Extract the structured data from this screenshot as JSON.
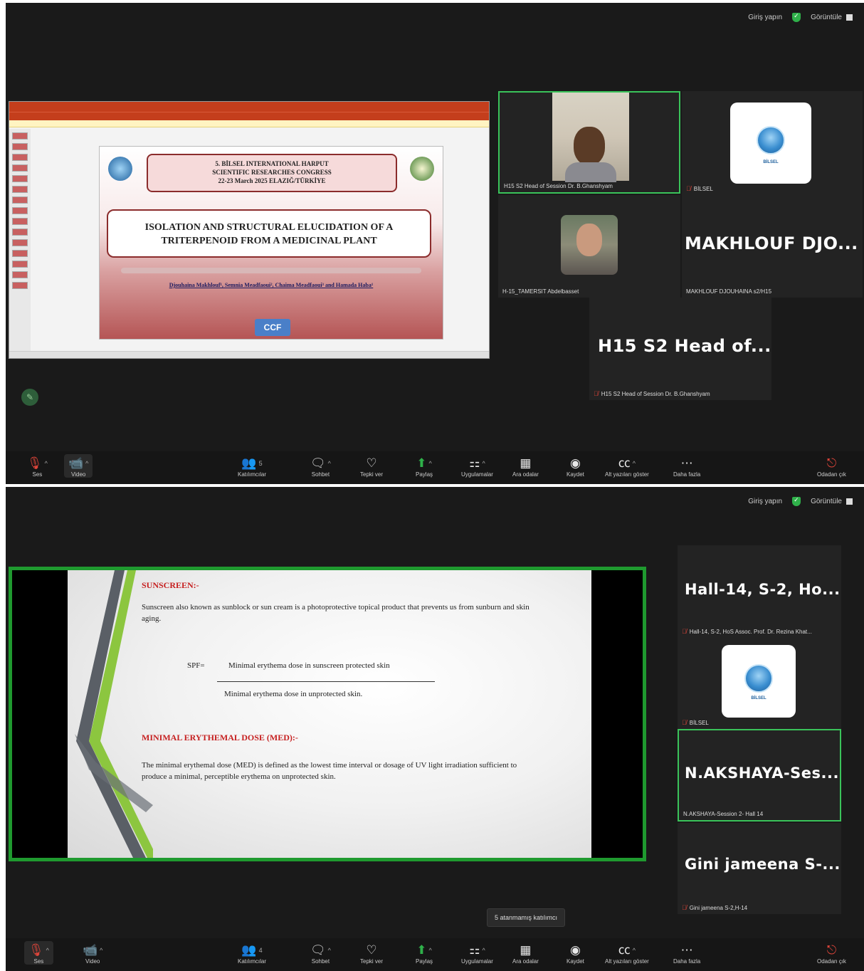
{
  "colors": {
    "accent_green": "#3ac35a",
    "mute_red": "#e0453a",
    "slide_header_red": "#c62020",
    "bg": "#1a1a1a"
  },
  "topbar": {
    "signin": "Giriş yapın",
    "view": "Görüntüle"
  },
  "screen1": {
    "slide": {
      "conf_line1": "5. BİLSEL INTERNATIONAL HARPUT",
      "conf_line2": "SCIENTIFIC RESEARCHES CONGRESS",
      "conf_line3": "22-23 March 2025 ELAZIĞ/TÜRKİYE",
      "title_line1": "ISOLATION AND STRUCTURAL ELUCIDATION OF A",
      "title_line2": "TRITERPENOID FROM A MEDICINAL PLANT",
      "authors": "Djouhaina Makhlouf¹, Semnia Meadfaoui², Chaima Meadfaoui³ and Hamada Haba¹",
      "ccf": "CCF"
    },
    "tiles": [
      {
        "label": "H15 S2 Head of Session Dr. B.Ghanshyam",
        "icon": "person-photo"
      },
      {
        "label": "BİLSEL",
        "icon": "bilsel-logo"
      },
      {
        "label": "H-15_TAMERSIT Abdelbasset",
        "icon": "person-photo"
      },
      {
        "name": "MAKHLOUF DJO...",
        "label": "MAKHLOUF DJOUHAINA s2/H15"
      },
      {
        "name": "H15 S2 Head of...",
        "label": "H15 S2 Head of Session Dr. B.Ghanshyam"
      }
    ]
  },
  "screen2": {
    "slide": {
      "head1": "SUNSCREEN:-",
      "para1": "Sunscreen also known as sunblock or sun cream is a photoprotective topical product that prevents us from sunburn and skin aging.",
      "spf_label": "SPF=",
      "numerator": "Minimal erythema dose in sunscreen  protected skin",
      "denominator": "Minimal erythema dose in unprotected skin.",
      "head2": "MINIMAL ERYTHEMAL DOSE (MED):-",
      "para2": "The minimal erythemal dose (MED) is defined as the lowest time interval or dosage of UV light irradiation sufficient to produce a minimal, perceptible erythema on unprotected skin."
    },
    "tiles": [
      {
        "name": "Hall-14, S-2, Ho...",
        "label": "Hall-14, S-2, HoS Assoc. Prof. Dr. Rezina Khat..."
      },
      {
        "label": "BİLSEL",
        "icon": "bilsel-logo"
      },
      {
        "name": "N.AKSHAYA-Ses...",
        "label": "N.AKSHAYA-Session 2- Hall 14"
      },
      {
        "name": "Gini jameena S-...",
        "label": "Gini jameena S-2,H-14"
      }
    ],
    "tooltip": "5 atanmamış katılımcı"
  },
  "toolbar": {
    "audio": "Ses",
    "video": "Video",
    "participants": "Katılımcılar",
    "participants_count_1": "5",
    "participants_count_2": "4",
    "chat": "Sohbet",
    "react": "Tepki ver",
    "share": "Paylaş",
    "apps": "Uygulamalar",
    "breakout": "Ara odalar",
    "record": "Kaydet",
    "captions": "Alt yazıları göster",
    "more": "Daha fazla",
    "leave": "Odadan çık"
  }
}
